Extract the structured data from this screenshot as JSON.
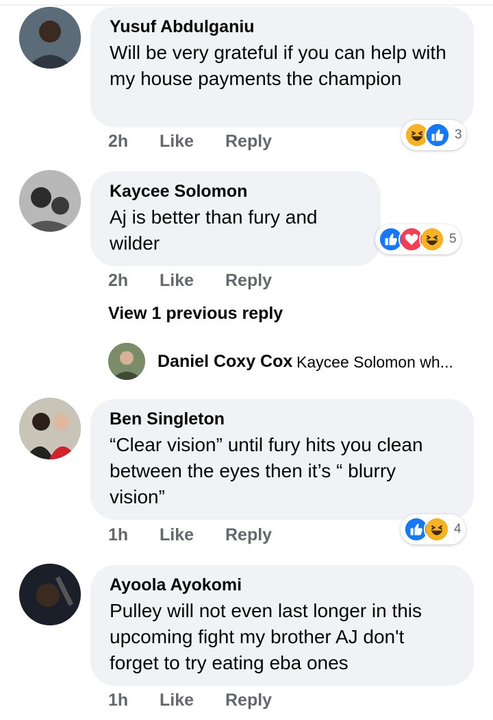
{
  "comments": [
    {
      "author": "Yusuf Abdulganiu",
      "text": "Will be very grateful if you can help with my house payments the champion",
      "time": "2h",
      "like_label": "Like",
      "reply_label": "Reply",
      "reactions": [
        "haha-icon",
        "like-icon"
      ],
      "reaction_count": "3"
    },
    {
      "author": "Kaycee Solomon",
      "text": "Aj is better than fury and wilder",
      "time": "2h",
      "like_label": "Like",
      "reply_label": "Reply",
      "reactions": [
        "like-icon",
        "love-icon",
        "haha-icon"
      ],
      "reaction_count": "5"
    },
    {
      "author": "Ben Singleton",
      "text": "“Clear vision” until fury hits you clean between the eyes then it’s “ blurry vision”",
      "time": "1h",
      "like_label": "Like",
      "reply_label": "Reply",
      "reactions": [
        "like-icon",
        "haha-icon"
      ],
      "reaction_count": "4"
    },
    {
      "author": "Ayoola Ayokomi",
      "text": "Pulley will not even last longer in this upcoming fight my brother AJ don't forget to try eating eba ones",
      "time": "1h",
      "like_label": "Like",
      "reply_label": "Reply"
    }
  ],
  "replies_thread": {
    "view_previous_label": "View 1 previous reply",
    "reply_author": "Daniel Coxy Cox",
    "reply_snippet": "Kaycee Solomon wh..."
  },
  "colors": {
    "bubble_bg": "#f0f2f5",
    "meta_text": "#65676b",
    "like_blue": "#1877f2",
    "love_red": "#f33e58",
    "haha_yellow": "#f7b125"
  }
}
